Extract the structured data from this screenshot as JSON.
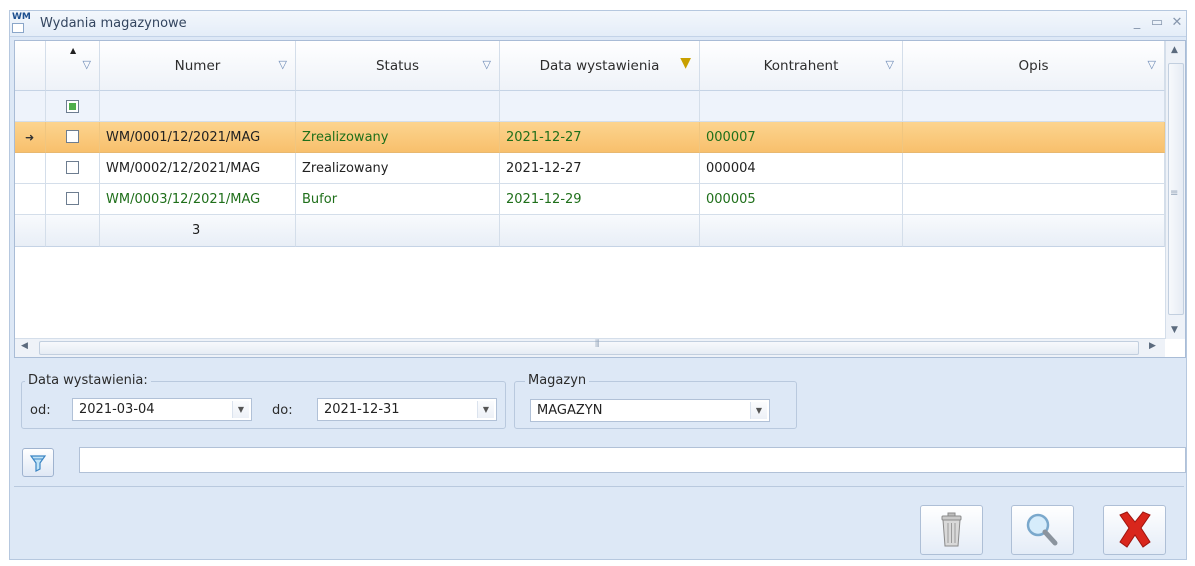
{
  "window": {
    "icon_text": "WM",
    "title": "Wydania magazynowe",
    "minimize": "_",
    "maximize": "▭",
    "close": "✕"
  },
  "grid": {
    "columns": [
      "Numer",
      "Status",
      "Data wystawienia",
      "Kontrahent",
      "Opis"
    ],
    "active_filter_column": "Data wystawienia",
    "rows": [
      {
        "numer": "WM/0001/12/2021/MAG",
        "status": "Zrealizowany",
        "data": "2021-12-27",
        "kontrahent": "000007",
        "opis": "",
        "selected": true,
        "color": "dark"
      },
      {
        "numer": "WM/0002/12/2021/MAG",
        "status": "Zrealizowany",
        "data": "2021-12-27",
        "kontrahent": "000004",
        "opis": "",
        "selected": false,
        "color": "dark"
      },
      {
        "numer": "WM/0003/12/2021/MAG",
        "status": "Bufor",
        "data": "2021-12-29",
        "kontrahent": "000005",
        "opis": "",
        "selected": false,
        "color": "green"
      }
    ],
    "summary_count": "3"
  },
  "filters": {
    "date_group_label": "Data wystawienia:",
    "from_label": "od:",
    "from_value": "2021-03-04",
    "to_label": "do:",
    "to_value": "2021-12-31",
    "warehouse_group_label": "Magazyn",
    "warehouse_value": "MAGAZYN",
    "text_filter_value": ""
  },
  "colors": {
    "selected_row": "#f8bf6b",
    "buffer_text": "#1f6f1a",
    "window_bg": "#dde8f6",
    "delete_x": "#d9261c"
  },
  "icons": [
    "filter-icon",
    "trash-icon",
    "magnifier-icon",
    "red-x-icon"
  ]
}
